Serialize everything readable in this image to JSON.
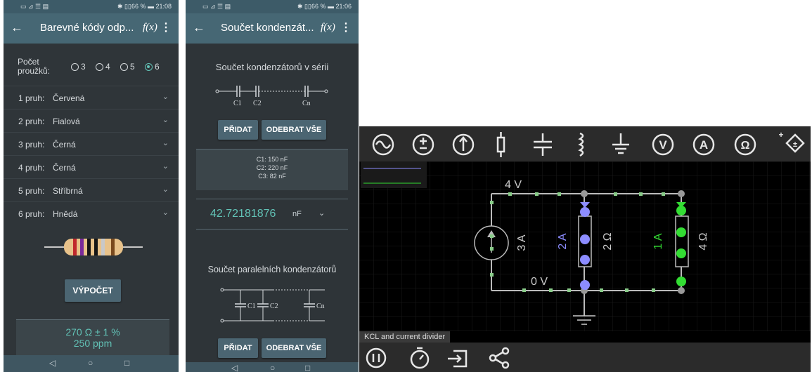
{
  "phone1": {
    "status_left": "▭ ⊿ ☰ ▤",
    "status_right": "✱ ▯▯66 % ▬ 21:08",
    "back_icon": "back-arrow-icon",
    "title": "Barevné kódy odp...",
    "fx": "f(x)",
    "more": "⋮",
    "stripe_count_label": "Počet proužků:",
    "stripe_options": [
      "3",
      "4",
      "5",
      "6"
    ],
    "stripe_selected": "6",
    "bands": [
      {
        "label": "1 pruh:",
        "value": "Červená"
      },
      {
        "label": "2 pruh:",
        "value": "Fialová"
      },
      {
        "label": "3 pruh:",
        "value": "Černá"
      },
      {
        "label": "4 pruh:",
        "value": "Černá"
      },
      {
        "label": "5 pruh:",
        "value": "Stříbrná"
      },
      {
        "label": "6 pruh:",
        "value": "Hnědá"
      }
    ],
    "band_colors": [
      "#c0282c",
      "#7a2a9a",
      "#151515",
      "#151515",
      "#c8c8c8",
      "#7a4a1e"
    ],
    "calc_button": "VÝPOČET",
    "result_line1": "270 Ω ± 1 %",
    "result_line2": "250 ppm"
  },
  "phone2": {
    "status_left": "▭ ⊿ ☰ ▤",
    "status_right": "✱ ▯▯66 % ▬ 21:06",
    "title": "Součet kondenzát...",
    "fx": "f(x)",
    "more": "⋮",
    "series_heading": "Součet kondenzátorů v sérii",
    "series_labels": [
      "C1",
      "C2",
      "Cn"
    ],
    "add_button": "PŘIDAT",
    "remove_button": "ODEBRAT VŠE",
    "capacitors": [
      "C1: 150 nF",
      "C2: 220 nF",
      "C3: 82 nF"
    ],
    "result_value": "42.72181876",
    "result_unit": "nF",
    "parallel_heading": "Součet paralelních kondenzátorů",
    "parallel_labels": [
      "C1",
      "C2",
      "Cn"
    ],
    "add_button2": "PŘIDAT",
    "remove_button2": "ODEBRAT VŠE"
  },
  "navbar": {
    "back": "◁",
    "home": "○",
    "recents": "□"
  },
  "simulator": {
    "toolbar_icons": [
      "ac-source-icon",
      "dc-voltage-source-icon",
      "current-source-icon",
      "resistor-icon",
      "capacitor-icon",
      "inductor-icon",
      "ground-icon",
      "voltmeter-icon",
      "ammeter-icon",
      "ohmmeter-icon",
      "add-component-icon"
    ],
    "toolbar_glyphs": [
      "∿",
      "±",
      "↑",
      "▯",
      "╪",
      "⌇",
      "⏚",
      "V",
      "A",
      "Ω",
      "±"
    ],
    "node_top_voltage": "4 V",
    "node_bottom_voltage": "0 V",
    "source_current": "3 A",
    "branch1_current": "2 A",
    "branch1_resistance": "2 Ω",
    "branch2_current": "1 A",
    "branch2_resistance": "4 Ω",
    "caption": "KCL and current divider",
    "bottom_icons": [
      "pause-icon",
      "timer-icon",
      "import-icon",
      "share-icon"
    ],
    "colors": {
      "branch1": "#8c8cff",
      "branch2": "#33dd33",
      "wire": "#bbbbbb",
      "node": "#88cc88"
    }
  }
}
